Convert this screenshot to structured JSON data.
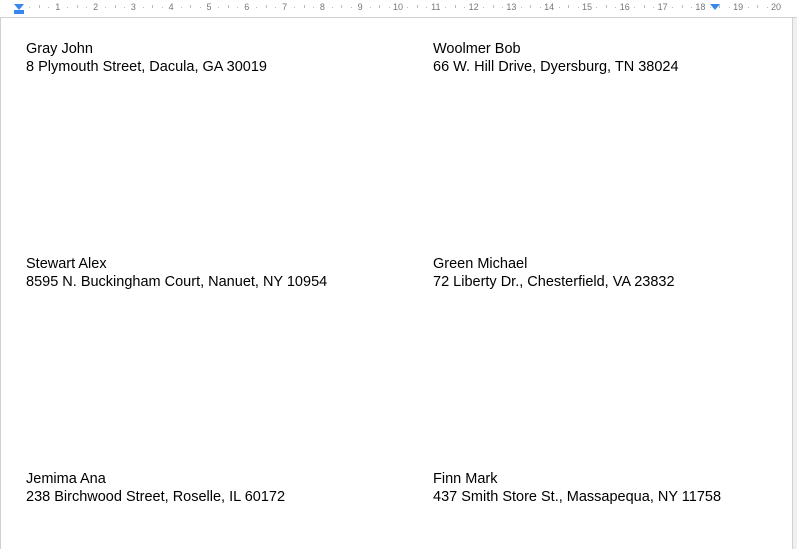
{
  "ruler": {
    "numbers": [
      "1",
      "2",
      "3",
      "4",
      "5",
      "6",
      "7",
      "8",
      "9",
      "10",
      "11",
      "12",
      "13",
      "14",
      "15",
      "16",
      "17",
      "19",
      "20"
    ]
  },
  "labels": [
    {
      "name": "Gray John",
      "address": "8 Plymouth Street, Dacula, GA 30019"
    },
    {
      "name": "Woolmer Bob",
      "address": "66 W. Hill Drive, Dyersburg, TN 38024"
    },
    {
      "name": "Stewart Alex",
      "address": "8595 N. Buckingham Court, Nanuet, NY 10954"
    },
    {
      "name": "Green Michael",
      "address": "72 Liberty Dr., Chesterfield, VA 23832"
    },
    {
      "name": "Jemima Ana",
      "address": "238 Birchwood Street, Roselle, IL 60172"
    },
    {
      "name": "Finn Mark",
      "address": "437 Smith Store St., Massapequa, NY 11758"
    }
  ]
}
